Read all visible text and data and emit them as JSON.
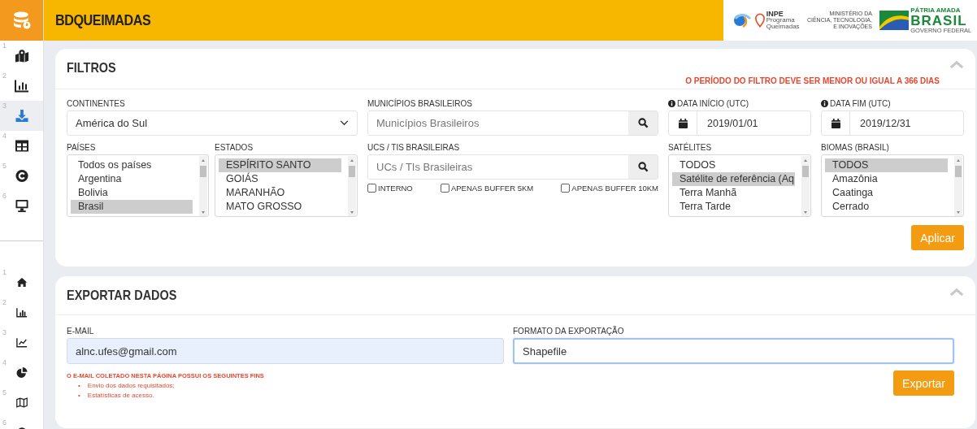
{
  "sidebar": {
    "items": [
      {
        "number": "1",
        "selected": false
      },
      {
        "number": "2",
        "selected": false
      },
      {
        "number": "3",
        "selected": true
      },
      {
        "number": "4",
        "selected": false
      },
      {
        "number": "5",
        "selected": false
      },
      {
        "number": "6",
        "selected": false
      }
    ],
    "bottom_items": [
      {
        "number": "1",
        "selected": false
      },
      {
        "number": "2",
        "selected": false
      },
      {
        "number": "3",
        "selected": false
      },
      {
        "number": "4",
        "selected": false
      },
      {
        "number": "5",
        "selected": false
      },
      {
        "number": "6",
        "selected": false
      }
    ]
  },
  "header": {
    "title": "BDQUEIMADAS",
    "inpe_logo": {
      "name": "INPE",
      "lines": [
        "Programa",
        "Queimadas"
      ]
    },
    "ministry_logo": {
      "lines": [
        "MINISTÉRIO DA",
        "CIÊNCIA, TECNOLOGIA,",
        "E INOVAÇÕES"
      ]
    },
    "brasil_logo": {
      "top": "PÁTRIA AMADA",
      "name": "BRASIL",
      "bottom": "GOVERNO FEDERAL"
    }
  },
  "filters": {
    "title": "FILTROS",
    "warning": "O PERÍODO DO FILTRO DEVE SER MENOR OU IGUAL A 366 DIAS",
    "continents": {
      "label": "CONTINENTES",
      "value": "América do Sul"
    },
    "countries": {
      "label": "PAÍSES",
      "items": [
        {
          "text": "Todos os países",
          "selected": false
        },
        {
          "text": "Argentina",
          "selected": false
        },
        {
          "text": "Bolivia",
          "selected": false
        },
        {
          "text": "Brasil",
          "selected": true
        }
      ]
    },
    "states": {
      "label": "ESTADOS",
      "items": [
        {
          "text": "ESPÍRITO SANTO",
          "selected": true
        },
        {
          "text": "GOIÁS",
          "selected": false
        },
        {
          "text": "MARANHÃO",
          "selected": false
        },
        {
          "text": "MATO GROSSO",
          "selected": false
        }
      ]
    },
    "municipalities": {
      "label": "MUNICÍPIOS BRASILEIROS",
      "placeholder": "Municípios Brasileiros"
    },
    "conservation_units": {
      "label": "UCS / TIS BRASILEIRAS",
      "placeholder": "UCs / TIs Brasileiras"
    },
    "options": [
      {
        "label": "INTERNO",
        "checked": false
      },
      {
        "label": "APENAS BUFFER 5KM",
        "checked": false
      },
      {
        "label": "APENAS BUFFER 10KM",
        "checked": false
      }
    ],
    "start_date": {
      "label": "DATA INÍCIO (UTC)",
      "value": "2019/01/01"
    },
    "end_date": {
      "label": "DATA FIM (UTC)",
      "value": "2019/12/31"
    },
    "satellites": {
      "label": "SATÉLITES",
      "items": [
        {
          "text": "TODOS",
          "selected": false
        },
        {
          "text": "Satélite de referência (Aq",
          "selected": true
        },
        {
          "text": "Terra Manhã",
          "selected": false
        },
        {
          "text": "Terra Tarde",
          "selected": false
        }
      ]
    },
    "biomes": {
      "label": "BIOMAS (BRASIL)",
      "items": [
        {
          "text": "TODOS",
          "selected": true
        },
        {
          "text": "Amazônia",
          "selected": false
        },
        {
          "text": "Caatinga",
          "selected": false
        },
        {
          "text": "Cerrado",
          "selected": false
        }
      ]
    },
    "apply_button": "Aplicar"
  },
  "export": {
    "title": "EXPORTAR DADOS",
    "email": {
      "label": "E-MAIL",
      "value": "alnc.ufes@gmail.com"
    },
    "format": {
      "label": "FORMATO DA EXPORTAÇÃO",
      "value": "Shapefile"
    },
    "notice": "O E-MAIL COLETADO NESTA PÁGINA POSSUI OS SEGUINTES FINS",
    "purposes": [
      {
        "marker": "•",
        "text": "Envio dos dados requisitados;"
      },
      {
        "marker": "•",
        "text": "Estatísticas de acesso."
      }
    ],
    "export_button": "Exportar"
  }
}
